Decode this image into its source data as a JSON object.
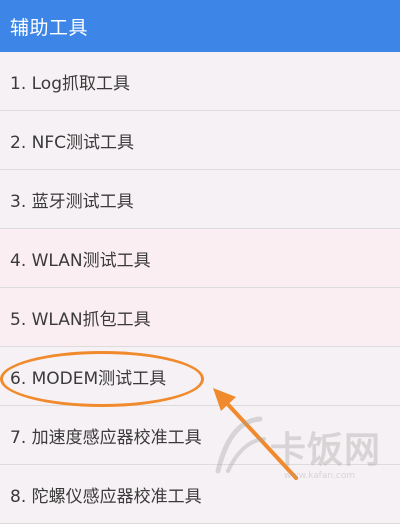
{
  "header": {
    "title": "辅助工具"
  },
  "menu": {
    "items": [
      {
        "label": "1. Log抓取工具"
      },
      {
        "label": "2. NFC测试工具"
      },
      {
        "label": "3. 蓝牙测试工具"
      },
      {
        "label": "4. WLAN测试工具"
      },
      {
        "label": "5. WLAN抓包工具"
      },
      {
        "label": "6. MODEM测试工具"
      },
      {
        "label": "7. 加速度感应器校准工具"
      },
      {
        "label": "8. 陀螺仪感应器校准工具"
      }
    ]
  },
  "annotation": {
    "highlighted_item": "6. MODEM测试工具",
    "color": "#f08a2c"
  },
  "watermark": {
    "text": "卡饭网",
    "url": "www.kafan.com"
  },
  "colors": {
    "app_bar": "#3d86e8",
    "list_background": "#f5f1f3"
  }
}
